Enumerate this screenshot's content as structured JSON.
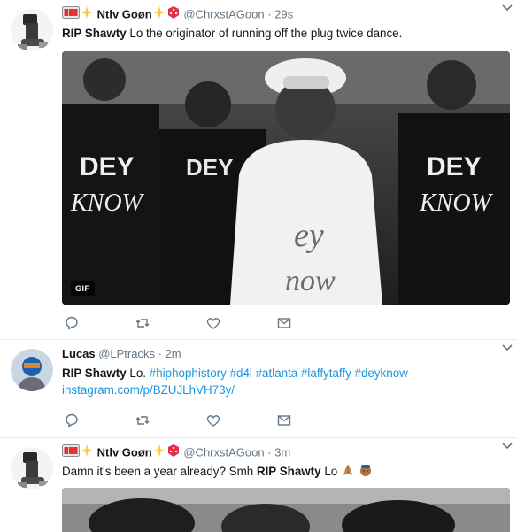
{
  "tweets": [
    {
      "fullname": "Ntlv Goøn",
      "username": "@ChrxstAGoon",
      "separator": "·",
      "time": "29s",
      "text_bold": "RIP Shawty",
      "text_rest": " Lo the originator of running off the plug twice dance.",
      "media": {
        "type": "gif",
        "badge": "GIF",
        "shirt_text_top": "DEY",
        "shirt_text_bottom": "KNOW",
        "center_shirt_top": "ey",
        "center_shirt_bottom": "now"
      }
    },
    {
      "fullname": "Lucas",
      "username": "@LPtracks",
      "separator": "·",
      "time": "2m",
      "text_bold": "RIP Shawty",
      "text_rest": " Lo. ",
      "hashtags": "#hiphophistory #d4l #atlanta #laffytaffy #deyknow",
      "link": "instagram.com/p/BZUJLhVH73y/"
    },
    {
      "fullname": "Ntlv Goøn",
      "username": "@ChrxstAGoon",
      "separator": "·",
      "time": "3m",
      "text_pre": "Damn it's been a year already? Smh ",
      "text_bold": "RIP Shawty",
      "text_rest": " Lo"
    }
  ],
  "actions": [
    "reply-icon",
    "retweet-icon",
    "like-icon",
    "direct-message-icon"
  ],
  "colors": {
    "link": "#1b95e0",
    "muted": "#657786",
    "divider": "#e6ecf0",
    "icon": "#657786"
  }
}
